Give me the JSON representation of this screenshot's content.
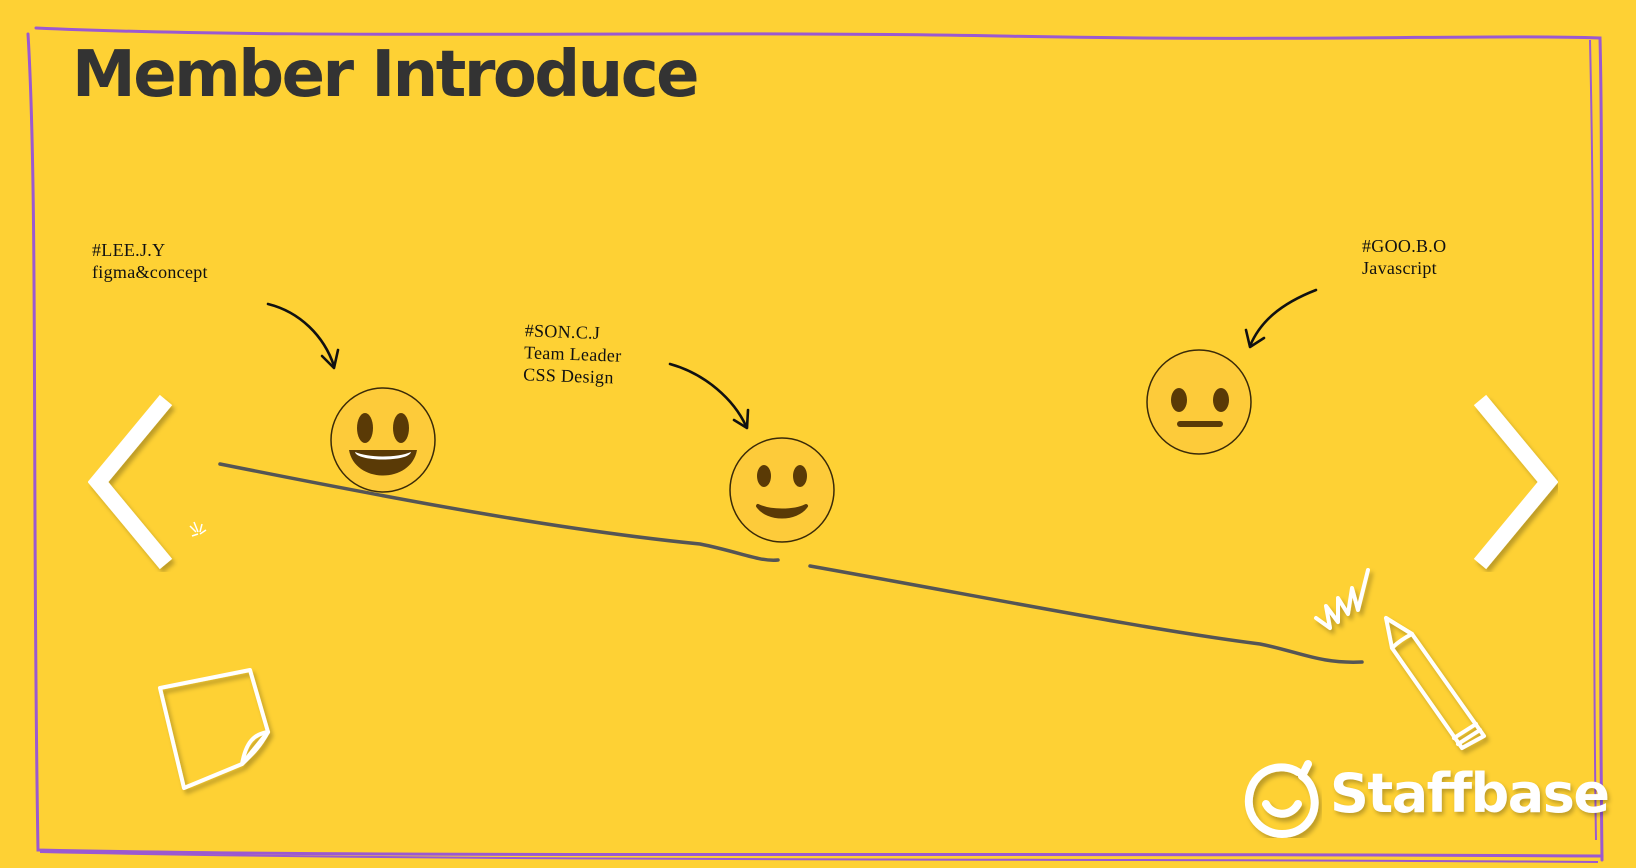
{
  "page": {
    "title": "Member Introduce"
  },
  "members": [
    {
      "handle": "#LEE.J.Y",
      "roles": [
        "figma&concept"
      ],
      "face": "grinning-face-icon"
    },
    {
      "handle": "#SON.C.J",
      "roles": [
        "Team Leader",
        "CSS Design"
      ],
      "face": "smiling-face-icon"
    },
    {
      "handle": "#GOO.B.O",
      "roles": [
        "Javascript"
      ],
      "face": "neutral-face-icon"
    }
  ],
  "navigation": {
    "prev_icon": "chevron-left-icon",
    "next_icon": "chevron-right-icon"
  },
  "decor": {
    "sticky_note_icon": "sticky-note-icon",
    "pencil_icon": "pencil-icon"
  },
  "brand": {
    "name": "Staffbase"
  },
  "colors": {
    "background": "#FED134",
    "frame": "#9B59D0",
    "title": "#333333",
    "face_fill": "#FDCB3A",
    "face_features": "#5A3A06",
    "line": "#555555",
    "white": "#FFFFFF"
  }
}
